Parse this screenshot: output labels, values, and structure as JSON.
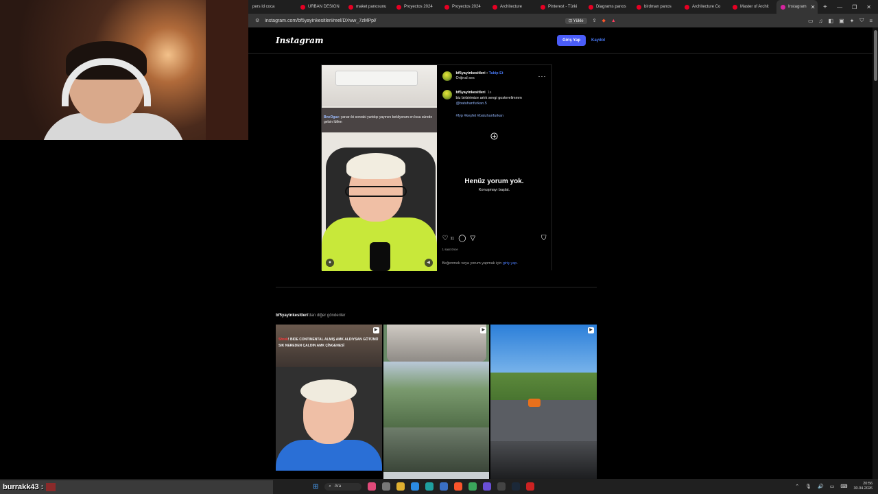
{
  "browser": {
    "tabs": [
      {
        "label": "pers ld coca"
      },
      {
        "label": "URBAN DESIGN"
      },
      {
        "label": "maket panosunu"
      },
      {
        "label": "Proyectos 2024"
      },
      {
        "label": "Proyectos 2024"
      },
      {
        "label": "Architecture"
      },
      {
        "label": "Pinterest - Türki"
      },
      {
        "label": "Diagrams panos"
      },
      {
        "label": "birdman panos"
      },
      {
        "label": "Architecture Co"
      },
      {
        "label": "Master of Archit"
      },
      {
        "label": "Instagram"
      }
    ],
    "new_tab": "+",
    "url": "instagram.com/bf5yayinkesitleri/reel/DXww_7zMPpl/",
    "install_label": "Yükle"
  },
  "instagram": {
    "logo": "Instagram",
    "login_button": "Giriş Yap",
    "signup_link": "Kaydol"
  },
  "post": {
    "username": "bf5yayinkesitleri",
    "follow": "Takip Et",
    "audio": "Orijinal ses",
    "separator": "•",
    "video_overlay_tag": "BneOguz",
    "video_overlay_text": ": yarıarı bi sonraki yurtdışı yayınını bekliyorum en kısa sürede gelsin lütfen",
    "caption_user": "bf5yayinkesitleri",
    "caption_time": "1s",
    "caption_text": "biz birbirimize artık sevgi gosterelimmm",
    "caption_mention": "@batuhanfurkan.5",
    "caption_hashtags": "#fyp #keşfet #batuhanfurkan",
    "no_comments_title": "Henüz yorum yok.",
    "no_comments_sub": "Konuşmayı başlat.",
    "likes": "11",
    "time_ago": "1 saat önce",
    "login_prompt_prefix": "Beğenmek veya yorum yapmak için ",
    "login_prompt_link": "giriş yap",
    "login_prompt_suffix": "."
  },
  "more_posts": {
    "username": "bf5yayinkesitleri",
    "suffix": "'dan diğer gönderiler",
    "thumb1_tag": "Shrek",
    "thumb1_text": "! BIDE CONTINENTAL ALMIŞ AMK ALDIYSAN GÖTÜMÜ SIK NEREDEN ÇALDIN AMK ÇİNGENESİ"
  },
  "taskbar": {
    "chat_user": "burrakk43 :",
    "search_label": "Ara",
    "time": "20:56",
    "date": "30.04.2026"
  },
  "colors": {
    "accent_blue": "#4a5df9",
    "link_blue": "#4a7bf9",
    "background": "#000000"
  }
}
